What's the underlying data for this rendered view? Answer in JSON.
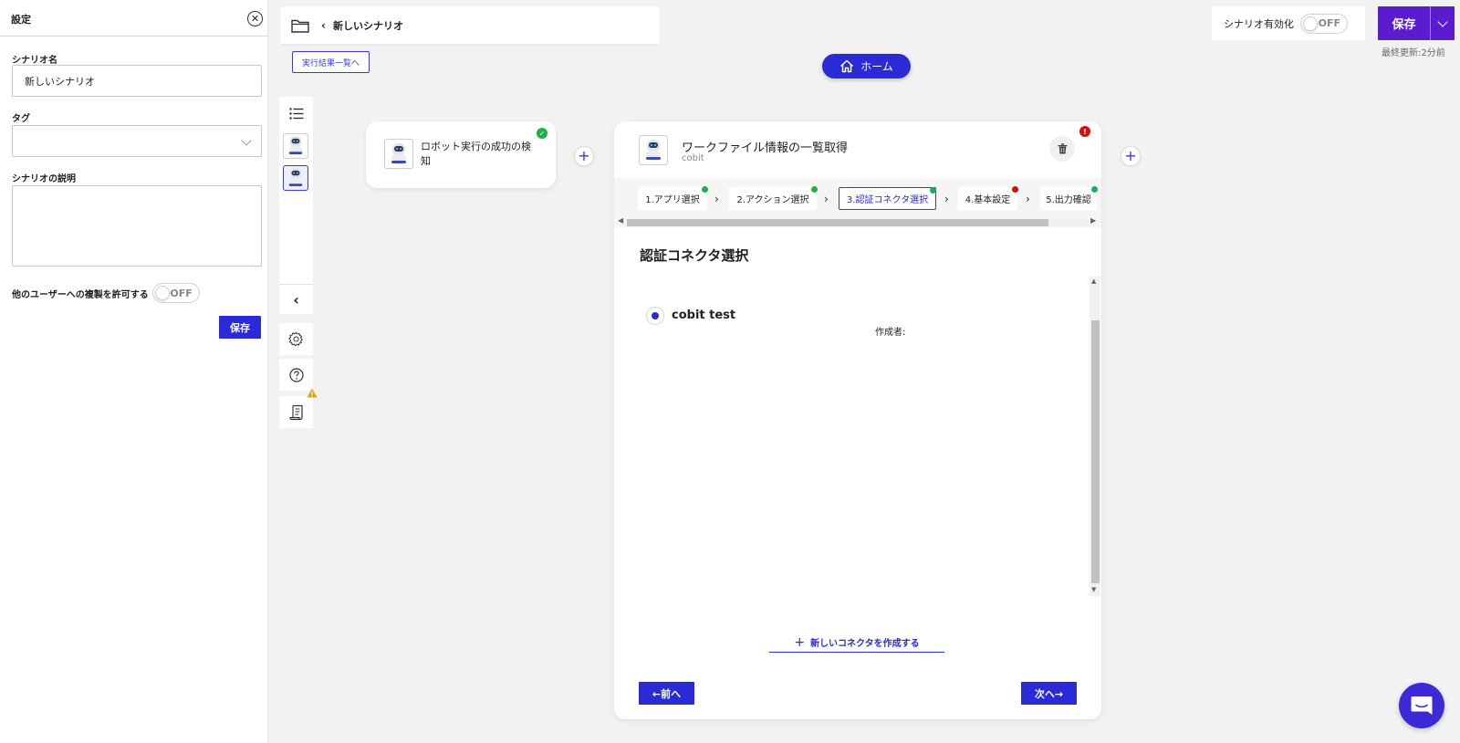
{
  "settings": {
    "title": "設定",
    "name_label": "シナリオ名",
    "name_value": "新しいシナリオ",
    "tag_label": "タグ",
    "tag_value": "",
    "description_label": "シナリオの説明",
    "description_value": "",
    "copy_label": "他のユーザーへの複製を許可する",
    "copy_toggle": "OFF",
    "save_label": "保存"
  },
  "header": {
    "scenario_title": "新しいシナリオ",
    "results_link": "実行結果一覧へ",
    "home_label": "ホーム",
    "enable_label": "シナリオ有効化",
    "enable_toggle": "OFF",
    "save_label": "保存",
    "last_updated": "最終更新:2分前"
  },
  "steps": [
    {
      "title": "ロボット実行の成功の検知",
      "status": "ok"
    }
  ],
  "action": {
    "title": "ワークファイル情報の一覧取得",
    "subtitle": "cobit",
    "tabs": [
      {
        "label": "1.アプリ選択",
        "status": "ok",
        "active": false
      },
      {
        "label": "2.アクション選択",
        "status": "ok",
        "active": false
      },
      {
        "label": "3.認証コネクタ選択",
        "status": "ok",
        "active": true
      },
      {
        "label": "4.基本設定",
        "status": "error",
        "active": false
      },
      {
        "label": "5.出力確認",
        "status": "ok",
        "active": false
      }
    ],
    "section_title": "認証コネクタ選択",
    "connectors": [
      {
        "name": "cobit test",
        "creator_label": "作成者:",
        "selected": true
      }
    ],
    "create_connector_label": "新しいコネクタを作成する",
    "prev_label": "←前へ",
    "next_label": "次へ→"
  },
  "colors": {
    "accent": "#2a2ad6",
    "save_purple": "#5b1ccf",
    "success": "#19b34a",
    "error": "#d60d0d",
    "warning": "#e0a21a"
  },
  "icons": [
    "folder-icon",
    "home-icon",
    "list-icon",
    "gear-icon",
    "help-icon",
    "log-icon",
    "trash-icon",
    "chat-icon",
    "robot-icon"
  ]
}
